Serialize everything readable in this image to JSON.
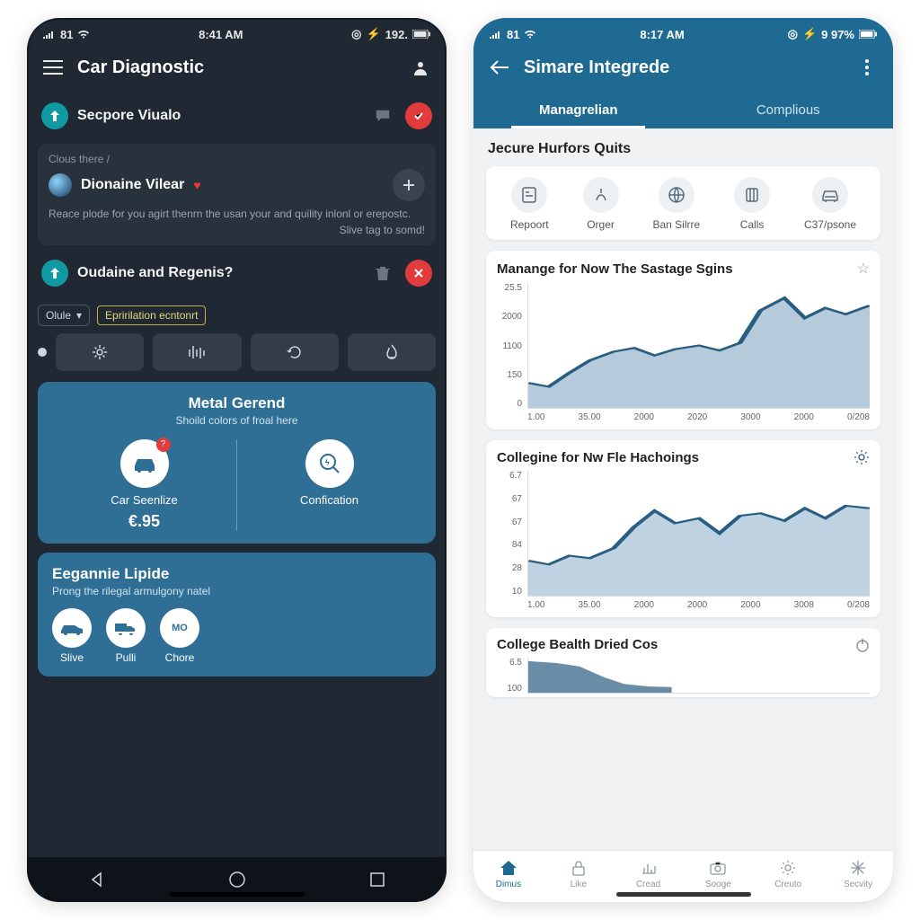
{
  "dark": {
    "status": {
      "left": "81",
      "time": "8:41 AM",
      "batt": "192."
    },
    "title": "Car Diagnostic",
    "row1": {
      "title": "Secpore Viualo"
    },
    "card1": {
      "breadcrumb": "Clous there /",
      "name": "Dionaine Vilear",
      "desc1": "Reace plode for you agirt thenrn the usan your and quility inlonl or erepostc.",
      "desc2": "Slive tag to somd!"
    },
    "row2": {
      "title": "Oudaine and Regenis?"
    },
    "select": "Olule",
    "chip": "Epririlation ecntonrt",
    "blue1": {
      "title": "Metal Gerend",
      "sub": "Shoild colors of froal here",
      "col1_label": "Car Seenlize",
      "col1_price": "€.95",
      "col2_label": "Confication",
      "badge": "?"
    },
    "blue2": {
      "title": "Eegannie Lipide",
      "sub": "Prong the rilegal armulgony natel",
      "items": [
        "Slive",
        "Pulli",
        "Chore"
      ],
      "mo": "MO"
    }
  },
  "light": {
    "status": {
      "left": "81",
      "time": "8:17 AM",
      "batt": "9 97%"
    },
    "title": "Simare Integrede",
    "tabs": [
      "Managrelian",
      "Complious"
    ],
    "section1": "Jecure Hurfors Quits",
    "actions": [
      "Repoort",
      "Orger",
      "Ban Silrre",
      "Calls",
      "C37/psone"
    ],
    "chart1": {
      "title": "Manange for Now The Sastage Sgins"
    },
    "chart2": {
      "title": "Collegine for Nw Fle Hachoings"
    },
    "chart3": {
      "title": "College Bealth Dried Cos"
    },
    "bottomnav": [
      "Dimus",
      "Like",
      "Cread",
      "Sooge",
      "Creuto",
      "Secvity"
    ]
  },
  "chart_data": [
    {
      "type": "area",
      "title": "Manange for Now The Sastage Sgins",
      "y_ticks": [
        "25.5",
        "2000",
        "1100",
        "150",
        "0"
      ],
      "x_ticks": [
        "1.00",
        "35.00",
        "2000",
        "2020",
        "3000",
        "2000",
        "0/208"
      ],
      "values": [
        140,
        120,
        300,
        500,
        650,
        700,
        620,
        700,
        750,
        680,
        820,
        1600,
        1900,
        1500,
        1700,
        1600,
        1750
      ]
    },
    {
      "type": "area",
      "title": "Collegine for Nw Fle Hachoings",
      "y_ticks": [
        "6.7",
        "67",
        "67",
        "84",
        "28",
        "10"
      ],
      "x_ticks": [
        "1.00",
        "35.00",
        "2000",
        "2000",
        "2000",
        "3008",
        "0/208"
      ],
      "values": [
        28,
        26,
        32,
        30,
        38,
        55,
        68,
        58,
        62,
        50,
        64,
        66,
        60,
        70,
        62,
        72,
        70
      ]
    },
    {
      "type": "area",
      "title": "College Bealth Dried Cos",
      "y_ticks": [
        "6.5",
        "100"
      ],
      "x_ticks": [],
      "values": [
        95,
        90,
        80,
        50,
        30,
        20,
        18
      ]
    }
  ]
}
